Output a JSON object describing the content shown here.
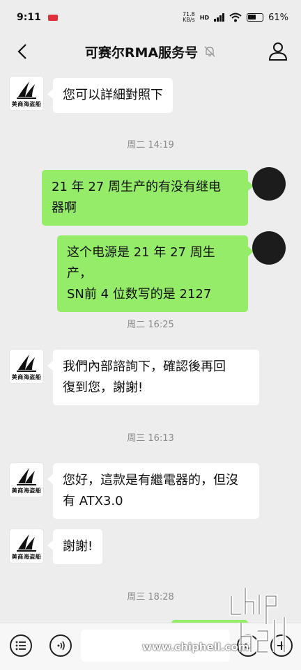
{
  "status_bar": {
    "time": "9:11",
    "net_speed": "71.8",
    "net_unit": "KB/s",
    "net_type": "HD",
    "battery": "61%"
  },
  "header": {
    "title": "可赛尔RMA服务号"
  },
  "avatar_text": "美商海盗船",
  "messages": [
    {
      "side": "in",
      "text": "您可以詳細對照下"
    },
    {
      "timestamp": "周二 14:19"
    },
    {
      "side": "out",
      "lines": [
        "21 年 27 周生产的有没有继电",
        "器啊"
      ]
    },
    {
      "side": "out",
      "lines": [
        "这个电源是 21 年 27 周生产，",
        "SN前 4 位数写的是 2127"
      ]
    },
    {
      "timestamp": "周二 16:25"
    },
    {
      "side": "in",
      "lines": [
        "我們內部諮詢下，確認後再回",
        "復到您，謝謝!"
      ]
    },
    {
      "timestamp": "周三 16:13"
    },
    {
      "side": "in",
      "lines": [
        "您好，這款是有繼電器的，但沒",
        "有 ATX3.0"
      ]
    },
    {
      "side": "in",
      "text": "謝謝!"
    },
    {
      "timestamp": "周三 18:28"
    }
  ],
  "watermark": {
    "site": "www.chiphell.com",
    "logo_text": "chip hell"
  },
  "colors": {
    "background": "#ededed",
    "outgoing_bubble": "#95ec69",
    "incoming_bubble": "#ffffff",
    "timestamp_text": "#8a8a8a"
  },
  "icons": {
    "back": "chevron-left-icon",
    "mute": "bell-off-icon",
    "profile": "person-icon",
    "voice": "voice-icon",
    "emoji": "emoji-icon",
    "more": "plus-icon",
    "menu": "list-icon"
  }
}
